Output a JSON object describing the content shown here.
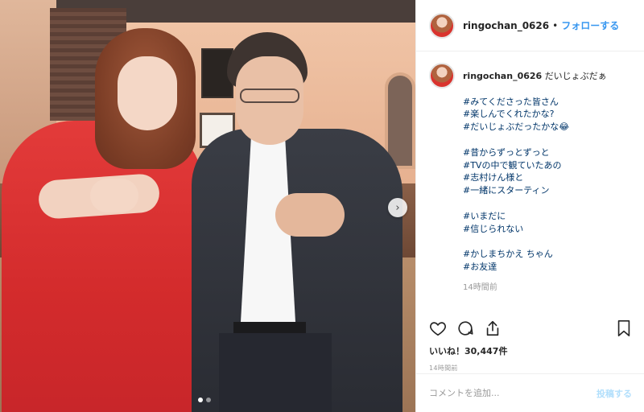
{
  "post": {
    "username": "ringochan_0626",
    "separator": "•",
    "follow_label": "フォローする",
    "caption": {
      "first_line": "だいじょぶだぁ",
      "hashtags_block1": [
        "#みてくださった皆さん",
        "#楽しんでくれたかな?",
        "#だいじょぶだったかな😂"
      ],
      "hashtags_block2": [
        "#昔からずっとずっと",
        "#TVの中で観ていたあの",
        "#志村けん様と",
        "#一緒にスターティン"
      ],
      "hashtags_block3": [
        "#いまだに",
        "#信じられない"
      ],
      "hashtags_block4": [
        "#かしまちかえ ちゃん",
        "#お友達"
      ],
      "timestamp": "14時間前"
    },
    "likes_label": "いいね！30,447件",
    "timestamp": "14時間前",
    "comment_placeholder": "コメントを追加...",
    "post_button": "投稿する",
    "carousel": {
      "current": 1,
      "total": 2
    }
  },
  "colors": {
    "link": "#3897f0",
    "hashtag": "#003569",
    "muted": "#999999",
    "dress": "#d32b2c"
  },
  "icons": [
    "heart-icon",
    "comment-icon",
    "share-icon",
    "bookmark-icon",
    "chevron-right-icon"
  ]
}
